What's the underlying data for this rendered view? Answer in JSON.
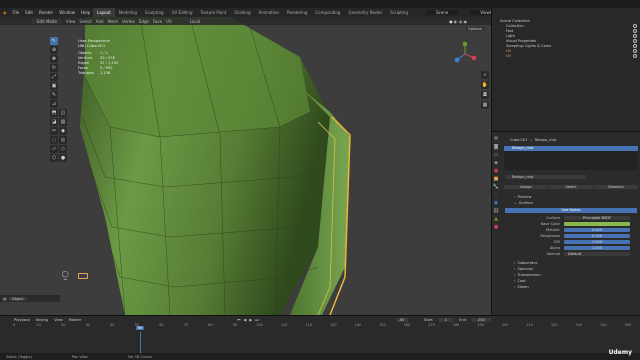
{
  "menu": [
    "File",
    "Edit",
    "Render",
    "Window",
    "Help"
  ],
  "workspaces": [
    "Layout",
    "Modeling",
    "Sculpting",
    "UV Editing",
    "Texture Paint",
    "Shading",
    "Animation",
    "Rendering",
    "Compositing",
    "Geometry Nodes",
    "Scripting"
  ],
  "scene": "Scene",
  "view_layer": "ViewLayer",
  "viewport": {
    "mode": "Edit Mode",
    "menus": [
      "View",
      "Select",
      "Add",
      "Mesh",
      "Vertex",
      "Edge",
      "Face",
      "UV"
    ],
    "orientation": "Local",
    "options": "Options",
    "info_title": "User Perspective",
    "info_object": "(66) Cube.001",
    "stats": [
      {
        "k": "Objects",
        "v": "1 / 1"
      },
      {
        "k": "Vertices",
        "v": "30 / 578"
      },
      {
        "k": "Edges",
        "v": "32 / 1,150"
      },
      {
        "k": "Faces",
        "v": "0 / 992"
      },
      {
        "k": "Triangles",
        "v": "1,156"
      }
    ]
  },
  "outliner": {
    "title": "Scene Collection",
    "items": [
      "Collection",
      "Fast",
      "Light",
      "Visual Properties",
      "Sampling: Lights & Cams",
      "UV",
      "UV"
    ]
  },
  "properties": {
    "object": "Cube.001",
    "material": "Retopo_mat",
    "slot": "Retopo_mat",
    "material_field": "Retopo_mat",
    "tabs": [
      "Assign",
      "Select",
      "Deselect"
    ],
    "preview": "Preview",
    "surface": "Surface",
    "use_nodes": "Use Nodes",
    "fields": [
      {
        "l": "Surface",
        "v": "Principled BSDF"
      },
      {
        "l": "Base Color",
        "v": ""
      },
      {
        "l": "Metallic",
        "v": "0.000"
      },
      {
        "l": "Roughness",
        "v": "0.500"
      },
      {
        "l": "IOR",
        "v": "1.500"
      },
      {
        "l": "Alpha",
        "v": "1.000"
      },
      {
        "l": "Normal",
        "v": "Default"
      }
    ],
    "sections": [
      "Subsurface",
      "Specular",
      "Transmission",
      "Coat",
      "Sheen"
    ]
  },
  "timeline": {
    "menus": [
      "Playback",
      "Keying",
      "View",
      "Marker"
    ],
    "current": "66",
    "start_label": "Start",
    "start": "1",
    "end_label": "End",
    "end": "250",
    "mode": "All",
    "ticks": [
      "0",
      "10",
      "20",
      "30",
      "40",
      "50",
      "60",
      "70",
      "80",
      "90",
      "100",
      "110",
      "120",
      "130",
      "140",
      "150",
      "160",
      "170",
      "180",
      "190",
      "200",
      "210",
      "220",
      "230",
      "240",
      "250"
    ]
  },
  "status": [
    "Select (Toggle)",
    "Pan View",
    "Set 3D Cursor"
  ],
  "watermark": "Udemy",
  "colors": {
    "accent": "#4772b3",
    "mesh": "#5e8a3a",
    "highlight": "#e8b838"
  }
}
